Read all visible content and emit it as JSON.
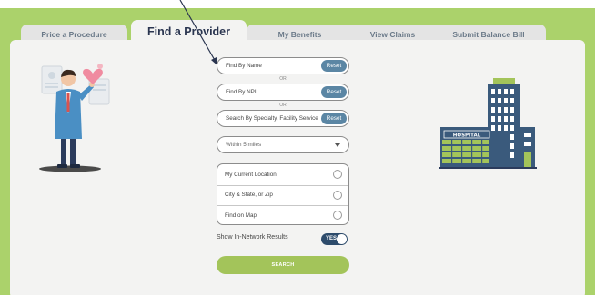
{
  "tabs": [
    {
      "label": "Price a Procedure",
      "active": false
    },
    {
      "label": "Find a Provider",
      "active": true
    },
    {
      "label": "My Benefits",
      "active": false
    },
    {
      "label": "View Claims",
      "active": false
    },
    {
      "label": "Submit Balance Bill",
      "active": false
    }
  ],
  "search": {
    "by_name": {
      "placeholder": "Find By Name",
      "reset_label": "Reset"
    },
    "or1": "OR",
    "by_npi": {
      "placeholder": "Find By NPI",
      "reset_label": "Reset"
    },
    "or2": "OR",
    "by_specialty": {
      "placeholder": "Search By Specialty, Facility Service",
      "reset_label": "Reset"
    },
    "distance": {
      "selected": "Within 5 miles"
    },
    "location_options": [
      {
        "label": "My Current Location"
      },
      {
        "label": "City & State, or Zip"
      },
      {
        "label": "Find on Map"
      }
    ],
    "in_network": {
      "label": "Show In-Network Results",
      "toggle_text": "YES",
      "on": true
    },
    "search_button": "SEARCH"
  },
  "illustrations": {
    "hospital_sign": "HOSPITAL",
    "doctor_icon": "doctor-illustration",
    "hospital_icon": "hospital-illustration"
  },
  "colors": {
    "accent_green": "#abd26b",
    "reset_blue": "#5b86a4",
    "toggle_navy": "#2d4b6b",
    "search_green": "#a3c45a"
  }
}
